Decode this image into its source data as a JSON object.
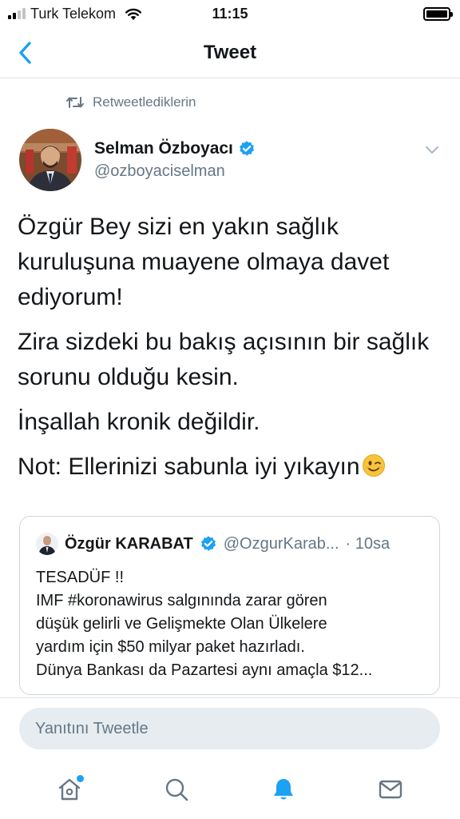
{
  "status_bar": {
    "carrier": "Turk Telekom",
    "time": "11:15"
  },
  "nav": {
    "title": "Tweet"
  },
  "tweet": {
    "retweet_label": "Retweetlediklerin",
    "author_name": "Selman Özboyacı",
    "author_handle": "@ozboyaciselman",
    "paragraphs": [
      "Özgür Bey sizi en yakın sağlık kuruluşuna muayene olmaya davet ediyorum!",
      "Zira sizdeki bu bakış açısının bir sağlık sorunu olduğu kesin.",
      "İnşallah kronik değildir.",
      "Not: Ellerinizi sabunla iyi yıkayın"
    ]
  },
  "quote": {
    "author_name": "Özgür KARABAT",
    "author_handle": "@OzgurKarab...",
    "time": "· 10sa",
    "lines": [
      "TESADÜF !!",
      "IMF #koronawirus salgınında zarar gören",
      "düşük gelirli ve Gelişmekte Olan Ülkelere",
      "yardım için $50 milyar paket hazırladı.",
      "Dünya Bankası da Pazartesi aynı amaçla $12..."
    ]
  },
  "reply": {
    "placeholder": "Yanıtını Tweetle"
  },
  "colors": {
    "accent": "#1da1f2",
    "secondary_text": "#657786",
    "reply_background": "#e6ecf0"
  },
  "icons": {
    "back": "chevron-left-icon",
    "retweet": "retweet-icon",
    "verified": "verified-badge-icon",
    "caret": "chevron-down-icon",
    "emoji": "winking-face-icon",
    "tabs": [
      "home-icon",
      "search-icon",
      "bell-icon",
      "mail-icon"
    ]
  }
}
